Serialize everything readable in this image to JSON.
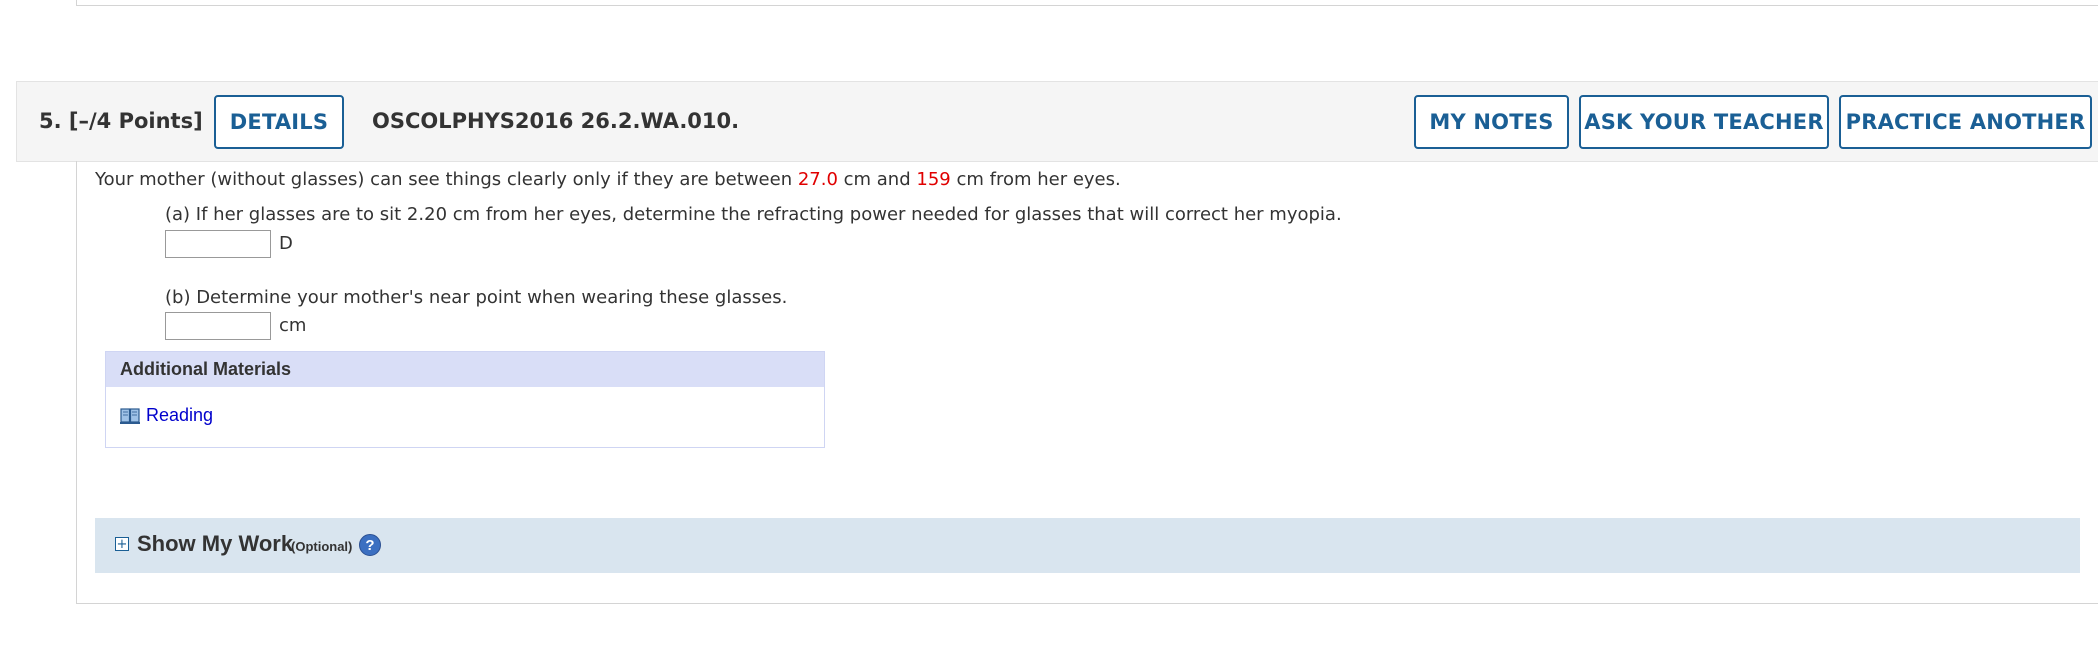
{
  "question": {
    "number_label": "5.  [–/4 Points]",
    "code": "OSCOLPHYS2016 26.2.WA.010.",
    "buttons": {
      "details": "DETAILS",
      "my_notes": "MY NOTES",
      "ask_teacher": "ASK YOUR TEACHER",
      "practice_another": "PRACTICE ANOTHER"
    },
    "stem": {
      "text_before": "Your mother (without glasses) can see things clearly only if they are between ",
      "value1": "27.0",
      "text_middle": " cm and ",
      "value2": "159",
      "text_after": " cm from her eyes."
    },
    "parts": [
      {
        "prompt": "(a) If her glasses are to sit 2.20 cm from her eyes, determine the refracting power needed for glasses that will correct her myopia.",
        "value": "",
        "unit": "D"
      },
      {
        "prompt": "(b) Determine your mother's near point when wearing these glasses.",
        "value": "",
        "unit": "cm"
      }
    ],
    "additional_materials": {
      "header": "Additional Materials",
      "links": [
        {
          "label": "Reading",
          "icon": "book-icon"
        }
      ]
    },
    "show_my_work": {
      "title": "Show My Work",
      "optional": "(Optional)",
      "help_glyph": "?"
    }
  },
  "colors": {
    "accent": "#1a5f95",
    "highlight_value": "#e00000",
    "materials_header_bg": "#d9def7",
    "show_work_bg": "#d9e5ef",
    "link": "#0000cc"
  }
}
